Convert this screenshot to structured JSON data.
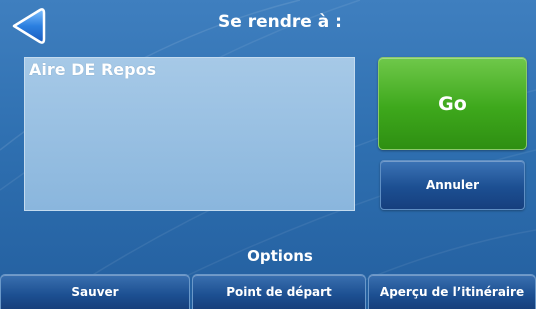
{
  "header": {
    "title": "Se rendre à :",
    "back_icon": "left-triangle-icon"
  },
  "destination": {
    "text": "Aire DE Repos"
  },
  "actions": {
    "go_label": "Go",
    "cancel_label": "Annuler"
  },
  "options": {
    "label": "Options",
    "buttons": [
      {
        "label": "Sauver"
      },
      {
        "label": "Point de départ"
      },
      {
        "label": "Aperçu de l’itinéraire"
      }
    ]
  },
  "colors": {
    "background": "#2f70b1",
    "go_button": "#3ea81c",
    "button_blue": "#1c4f92",
    "input_fill": "#9bc1e3",
    "back_arrow": "#2b7fe0"
  }
}
